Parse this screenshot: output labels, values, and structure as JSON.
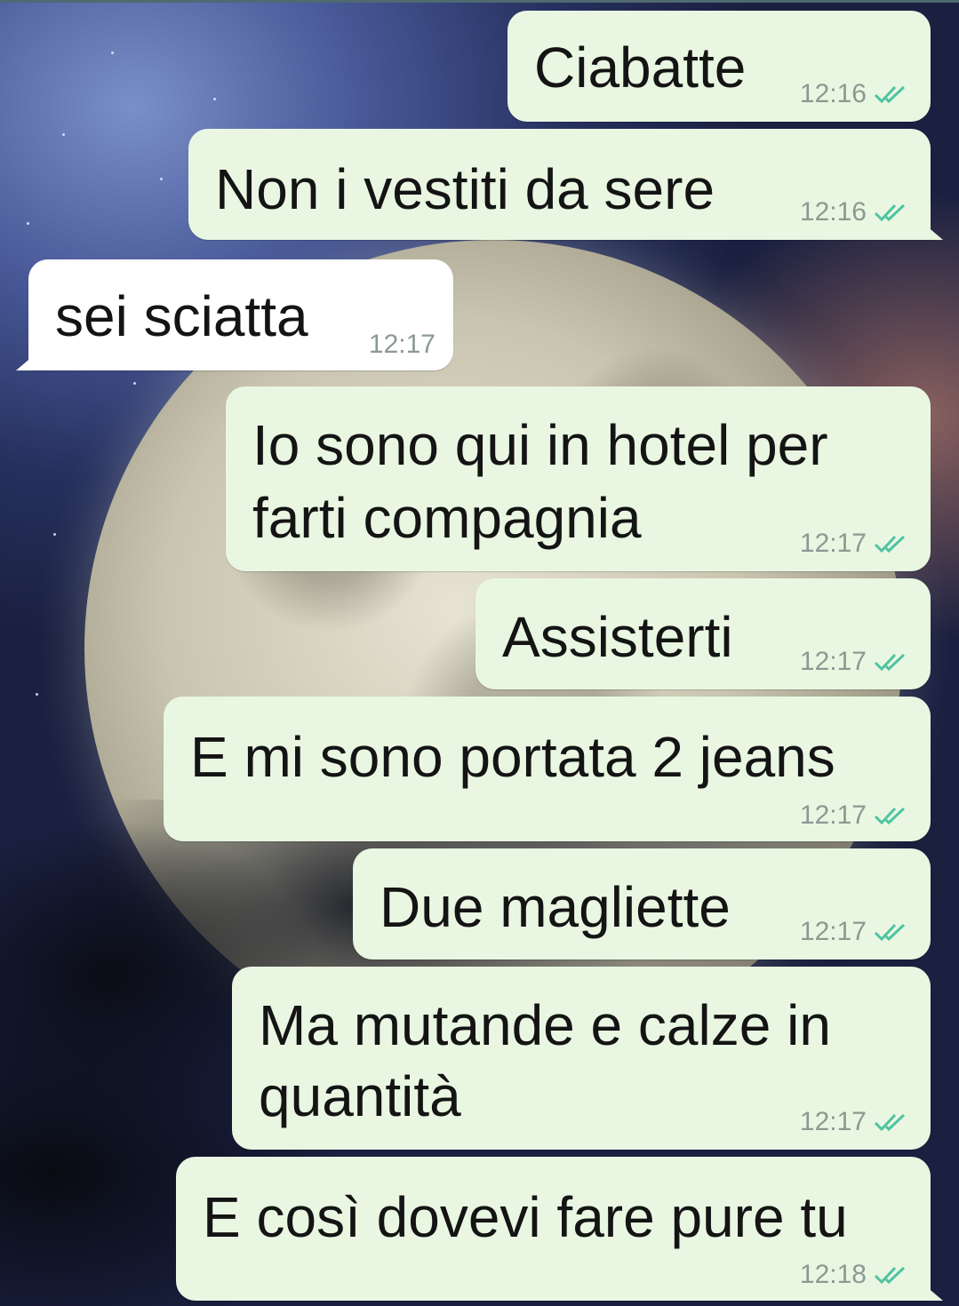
{
  "chat": {
    "messages": [
      {
        "direction": "out",
        "text": "Ciabatte",
        "time": "12:16",
        "status": "read"
      },
      {
        "direction": "out",
        "text": "Non i vestiti da sere",
        "time": "12:16",
        "status": "read"
      },
      {
        "direction": "in",
        "text": "sei sciatta",
        "time": "12:17"
      },
      {
        "direction": "out",
        "line1": "Io sono qui in hotel per",
        "line2": "farti compagnia",
        "time": "12:17",
        "status": "read"
      },
      {
        "direction": "out",
        "text": "Assisterti",
        "time": "12:17",
        "status": "read"
      },
      {
        "direction": "out",
        "text": "E mi sono portata 2 jeans",
        "time": "12:17",
        "status": "read"
      },
      {
        "direction": "out",
        "text": "Due magliette",
        "time": "12:17",
        "status": "read"
      },
      {
        "direction": "out",
        "line1": "Ma mutande e calze in",
        "line2": "quantità",
        "time": "12:17",
        "status": "read"
      },
      {
        "direction": "out",
        "text": "E così dovevi fare pure tu",
        "time": "12:18",
        "status": "read"
      }
    ]
  },
  "colors": {
    "outgoing_bubble": "#e9f7e2",
    "incoming_bubble": "#ffffff",
    "read_ticks": "#4fc3a1",
    "timestamp": "#8a9a92"
  },
  "icons": {
    "read_receipt": "double-check-icon",
    "wallpaper": "full-moon-night-sky"
  }
}
